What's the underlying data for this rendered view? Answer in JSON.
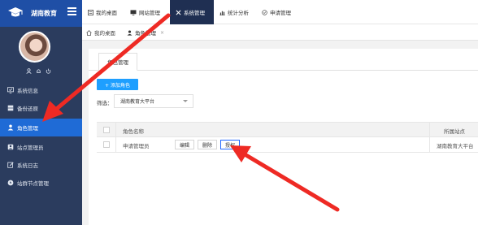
{
  "brand": {
    "name": "湖南教育"
  },
  "sidebar": {
    "items": [
      {
        "label": "系统信息",
        "icon": "monitor-check-icon"
      },
      {
        "label": "备份还原",
        "icon": "database-icon"
      },
      {
        "label": "角色管理",
        "icon": "user-icon",
        "active": true
      },
      {
        "label": "站点管理员",
        "icon": "user-admin-icon"
      },
      {
        "label": "系统日志",
        "icon": "edit-log-icon"
      },
      {
        "label": "站群节点管理",
        "icon": "node-icon"
      }
    ]
  },
  "topbar": {
    "items": [
      {
        "label": "我的桌面",
        "icon": "desktop-icon"
      },
      {
        "label": "网站管理",
        "icon": "monitor-icon"
      },
      {
        "label": "系统管理",
        "icon": "tools-icon",
        "active": true
      },
      {
        "label": "统计分析",
        "icon": "bar-chart-icon"
      },
      {
        "label": "申请管理",
        "icon": "circle-check-icon"
      }
    ]
  },
  "tabs": [
    {
      "label": "我的桌面",
      "icon": "home-icon"
    },
    {
      "label": "角色管理",
      "icon": "user-icon",
      "active": true,
      "close": "×"
    }
  ],
  "panel": {
    "subtab": "角色管理",
    "add_button": "+ 添加角色",
    "filter_label": "筛选：",
    "filter_value": "湖南教育大平台"
  },
  "table": {
    "headers": {
      "name": "角色名称",
      "site": "所属站点"
    },
    "rows": [
      {
        "name": "申请管理员",
        "site": "湖南教育大平台",
        "edit": "编辑",
        "delete": "删除",
        "grant": "授权"
      }
    ]
  },
  "colors": {
    "sidebar": "#2b3c5e",
    "brand": "#1f4fa6",
    "active": "#1f6bd6",
    "add_button": "#1e9fff",
    "arrow": "#ee2a24"
  }
}
